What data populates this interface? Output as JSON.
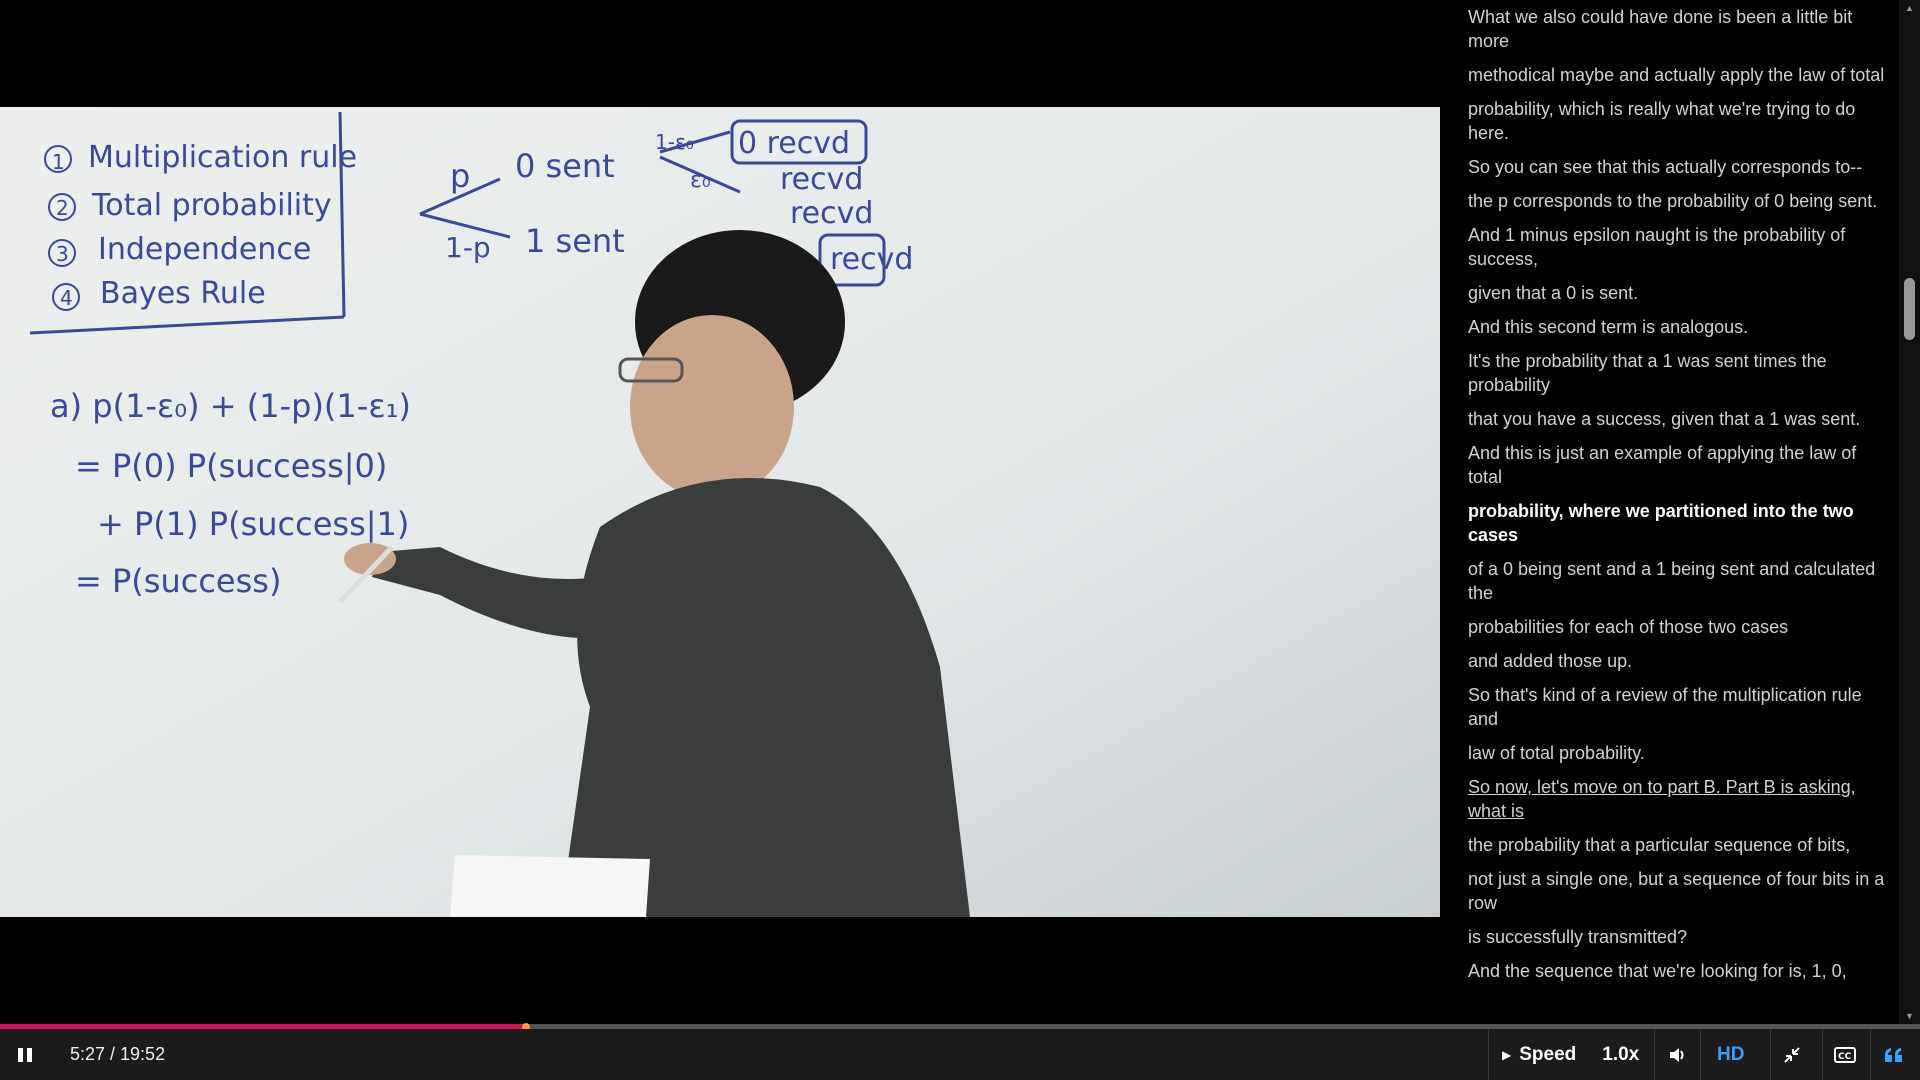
{
  "player": {
    "current_time": "5:27",
    "duration": "19:52",
    "time_display": "5:27 / 19:52",
    "progress_fraction": 0.274,
    "speed_label": "Speed",
    "speed_value": "1.0x",
    "hd_label": "HD"
  },
  "icons": {
    "play_pause": "pause-icon",
    "volume": "volume-icon",
    "fullscreen": "exit-fullscreen-icon",
    "captions": "closed-captions-icon",
    "transcript": "transcript-quote-icon"
  },
  "colors": {
    "progress_played": "#c2185b",
    "progress_handle": "#ff9a3c",
    "accent_blue": "#3aa0ff"
  },
  "whiteboard": {
    "rules": [
      "Multiplication rule",
      "Total probability",
      "Independence",
      "Bayes Rule"
    ],
    "tree": [
      "p",
      "0 sent",
      "1-p",
      "1 sent",
      "1-ε₀",
      "ε₀",
      "0 recvd",
      "recvd",
      "recvd",
      "recvd"
    ],
    "equations": [
      "a) p(1-ε₀) + (1-p)(1-ε₁)",
      "= P(0) P(success|0)",
      "+ P(1) P(success|1)",
      "= P(success)"
    ]
  },
  "transcript": {
    "lines": [
      "What we also could have done is been a little bit more",
      "methodical maybe and actually apply the law of total",
      "probability, which is really what we're trying to do here.",
      "So you can see that this actually corresponds to--",
      "the p corresponds to the probability of 0 being sent.",
      "And 1 minus epsilon naught is the probability of success,",
      "given that a 0 is sent.",
      "And this second term is analogous.",
      "It's the probability that a 1 was sent times the probability",
      "that you have a success, given that a 1 was sent.",
      "And this is just an example of applying the law of total",
      "probability, where we partitioned into the two cases",
      "of a 0 being sent and a 1 being sent and calculated the",
      "probabilities for each of those two cases",
      "and added those up.",
      "So that's kind of a review of the multiplication rule and",
      "law of total probability.",
      "So now, let's move on to part B. Part B is asking, what is",
      "the probability that a particular sequence of bits,",
      "not just a single one, but a sequence of four bits in a row",
      "is successfully transmitted?",
      "And the sequence that we're looking for is, 1, 0,"
    ],
    "active_index": 11,
    "focused_index": 17
  }
}
